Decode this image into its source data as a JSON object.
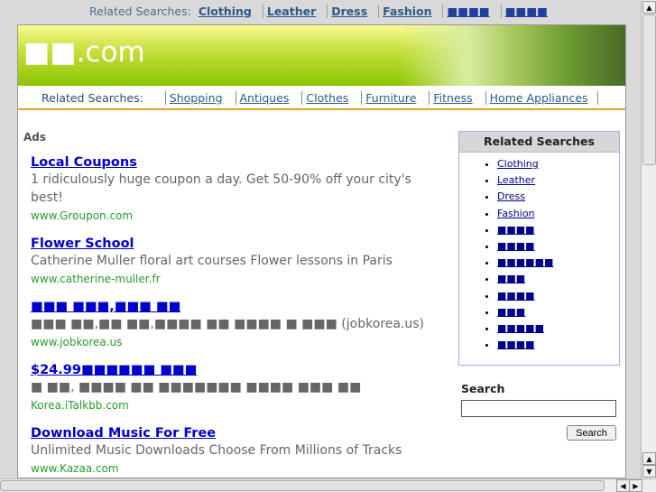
{
  "top_bar": {
    "label": "Related Searches:",
    "links": [
      "Clothing",
      "Leather",
      "Dress",
      "Fashion",
      "■■■■",
      "■■■■"
    ]
  },
  "logo": {
    "text": "■■.com"
  },
  "nav": {
    "label": "Related Searches:",
    "links": [
      "Shopping",
      "Antiques",
      "Clothes",
      "Furniture",
      "Fitness",
      "Home Appliances"
    ]
  },
  "ads": {
    "label": "Ads",
    "items": [
      {
        "title": "Local Coupons",
        "desc": "1 ridiculously huge coupon a day. Get 50-90% off your city's best!",
        "url": "www.Groupon.com"
      },
      {
        "title": "Flower School",
        "desc": "Catherine Muller floral art courses Flower lessons in Paris",
        "url": "www.catherine-muller.fr"
      },
      {
        "title": "■■■ ■■■,■■■ ■■",
        "desc": "■■■ ■■,■■ ■■,■■■■ ■■ ■■■■ ■ ■■■ (jobkorea.us)",
        "url": "www.jobkorea.us"
      },
      {
        "title": "$24.99■■■■■■ ■■■",
        "desc": "■ ■■, ■■■■ ■■ ■■■■■■■ ■■■■ ■■■ ■■",
        "url": "Korea.iTalkbb.com"
      },
      {
        "title": "Download Music For Free",
        "desc": "Unlimited Music Downloads Choose From Millions of Tracks",
        "url": "www.Kazaa.com"
      }
    ]
  },
  "related": {
    "title": "Related Searches",
    "items": [
      "Clothing",
      "Leather",
      "Dress",
      "Fashion",
      "■■■■",
      "■■■■",
      "■■■■■■",
      "■■■",
      "■■■■",
      "■■■",
      "■■■■■",
      "■■■■"
    ]
  },
  "search": {
    "title": "Search",
    "value": "",
    "button": "Search"
  }
}
